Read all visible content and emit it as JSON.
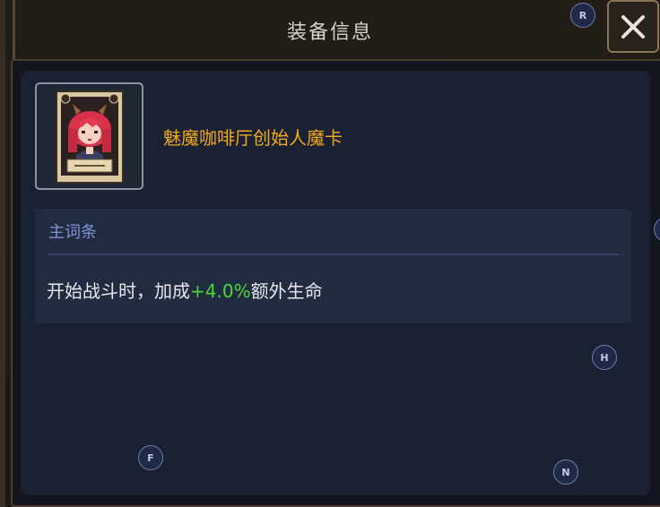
{
  "window": {
    "title": "装备信息",
    "close_icon": "close-x-icon"
  },
  "item": {
    "name": "魅魔咖啡厅创始人魔卡",
    "icon": "succubus-card-icon",
    "name_color": "#f0a81f"
  },
  "affix": {
    "header": "主词条",
    "text_prefix": "开始战斗时，加成",
    "value": "+4.0%",
    "text_suffix": "额外生命",
    "value_color": "#4ad63c"
  },
  "key_hints": {
    "r": "R",
    "h": "H",
    "f": "F",
    "n": "N"
  }
}
